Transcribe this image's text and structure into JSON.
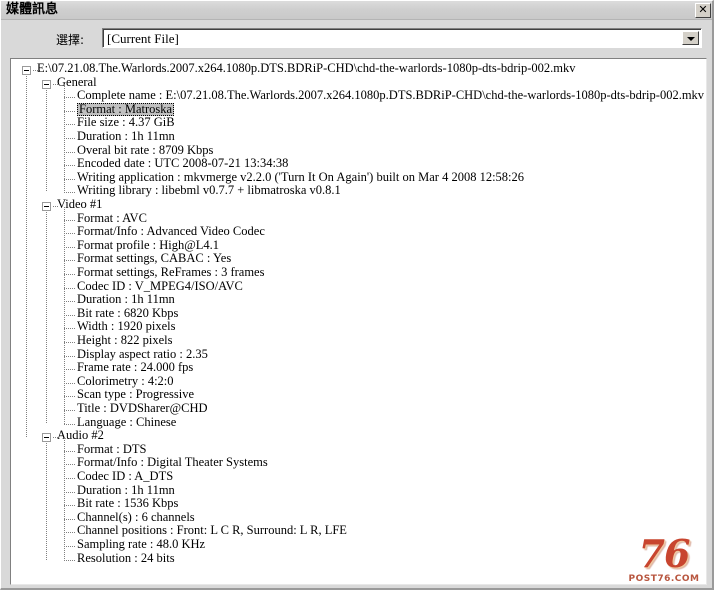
{
  "window": {
    "title": "媒體訊息",
    "close_label": "✕"
  },
  "selector": {
    "label": "選擇:",
    "value": "[Current File]",
    "arrow_icon": "chevron-down-icon"
  },
  "tree": {
    "root": {
      "label": "E:\\07.21.08.The.Warlords.2007.x264.1080p.DTS.BDRiP-CHD\\chd-the-warlords-1080p-dts-bdrip-002.mkv",
      "expanded": true
    },
    "sections": [
      {
        "label": "General",
        "expanded": true,
        "rows": [
          "Complete name : E:\\07.21.08.The.Warlords.2007.x264.1080p.DTS.BDRiP-CHD\\chd-the-warlords-1080p-dts-bdrip-002.mkv",
          "Format : Matroska",
          "File size : 4.37 GiB",
          "Duration : 1h 11mn",
          "Overal bit rate : 8709 Kbps",
          "Encoded date : UTC 2008-07-21 13:34:38",
          "Writing application : mkvmerge v2.2.0 ('Turn It On Again') built on Mar  4 2008 12:58:26",
          "Writing library : libebml v0.7.7 + libmatroska v0.8.1"
        ],
        "selected_index": 1
      },
      {
        "label": "Video #1",
        "expanded": true,
        "rows": [
          "Format : AVC",
          "Format/Info : Advanced Video Codec",
          "Format profile : High@L4.1",
          "Format settings, CABAC : Yes",
          "Format settings, ReFrames : 3 frames",
          "Codec ID : V_MPEG4/ISO/AVC",
          "Duration : 1h 11mn",
          "Bit rate : 6820 Kbps",
          "Width : 1920 pixels",
          "Height : 822 pixels",
          "Display aspect ratio : 2.35",
          "Frame rate : 24.000 fps",
          "Colorimetry : 4:2:0",
          "Scan type : Progressive",
          "Title : DVDSharer@CHD",
          "Language : Chinese"
        ],
        "selected_index": -1
      },
      {
        "label": "Audio #2",
        "expanded": true,
        "rows": [
          "Format : DTS",
          "Format/Info : Digital Theater Systems",
          "Codec ID : A_DTS",
          "Duration : 1h 11mn",
          "Bit rate : 1536 Kbps",
          "Channel(s) : 6 channels",
          "Channel positions : Front: L C R, Surround: L R, LFE",
          "Sampling rate : 48.0 KHz",
          "Resolution : 24 bits"
        ],
        "selected_index": -1
      }
    ]
  },
  "watermark": {
    "logo": "76",
    "domain": "POST76.COM"
  }
}
